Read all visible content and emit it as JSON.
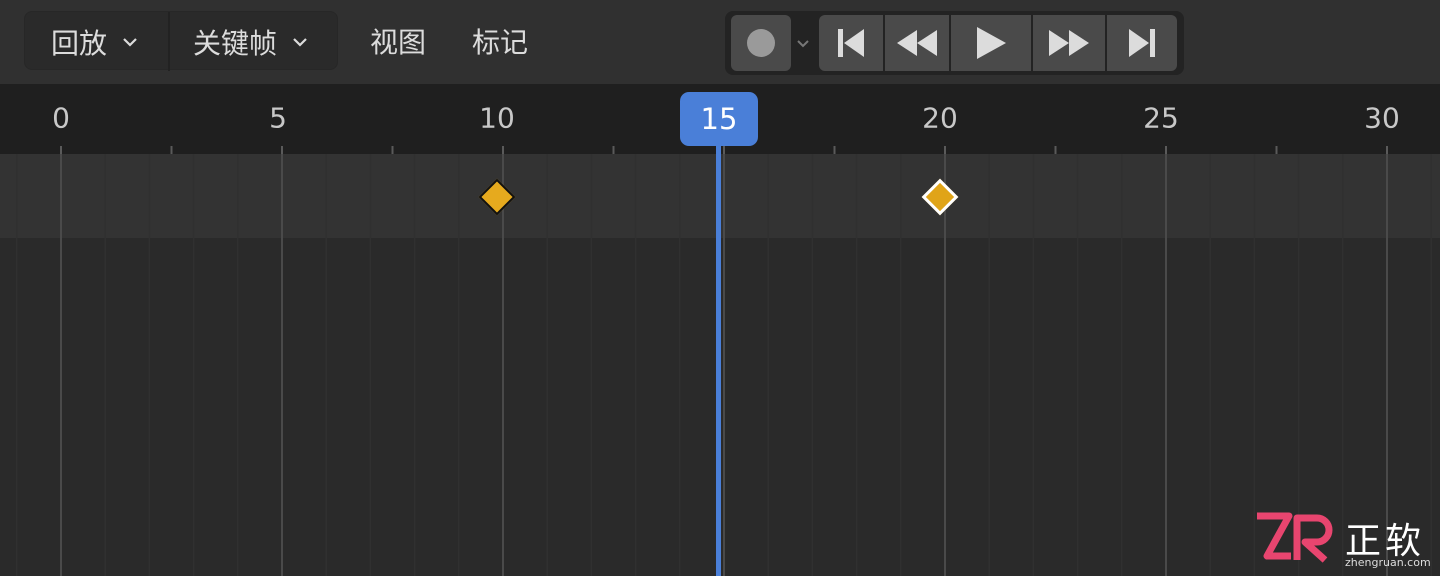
{
  "header": {
    "menus": {
      "playback": "回放",
      "keyframe": "关键帧",
      "view": "视图",
      "marker": "标记"
    },
    "transport": {
      "buttons": [
        "auto-key-record",
        "jump-to-start",
        "jump-to-previous-keyframe",
        "play",
        "jump-to-next-keyframe",
        "jump-to-end"
      ]
    }
  },
  "ruler": {
    "labels": [
      "0",
      "5",
      "10",
      "15",
      "20",
      "25",
      "30"
    ],
    "current_frame": "15"
  },
  "keyframes": [
    {
      "frame": 10,
      "selected": false
    },
    {
      "frame": 20,
      "selected": true
    }
  ],
  "watermark": {
    "logo": "ZR",
    "name": "正软",
    "url": "zhengruan.com"
  },
  "colors": {
    "accent": "#4a7fd8",
    "keyframe": "#e6aa1e",
    "background": "#2a2a2a"
  }
}
